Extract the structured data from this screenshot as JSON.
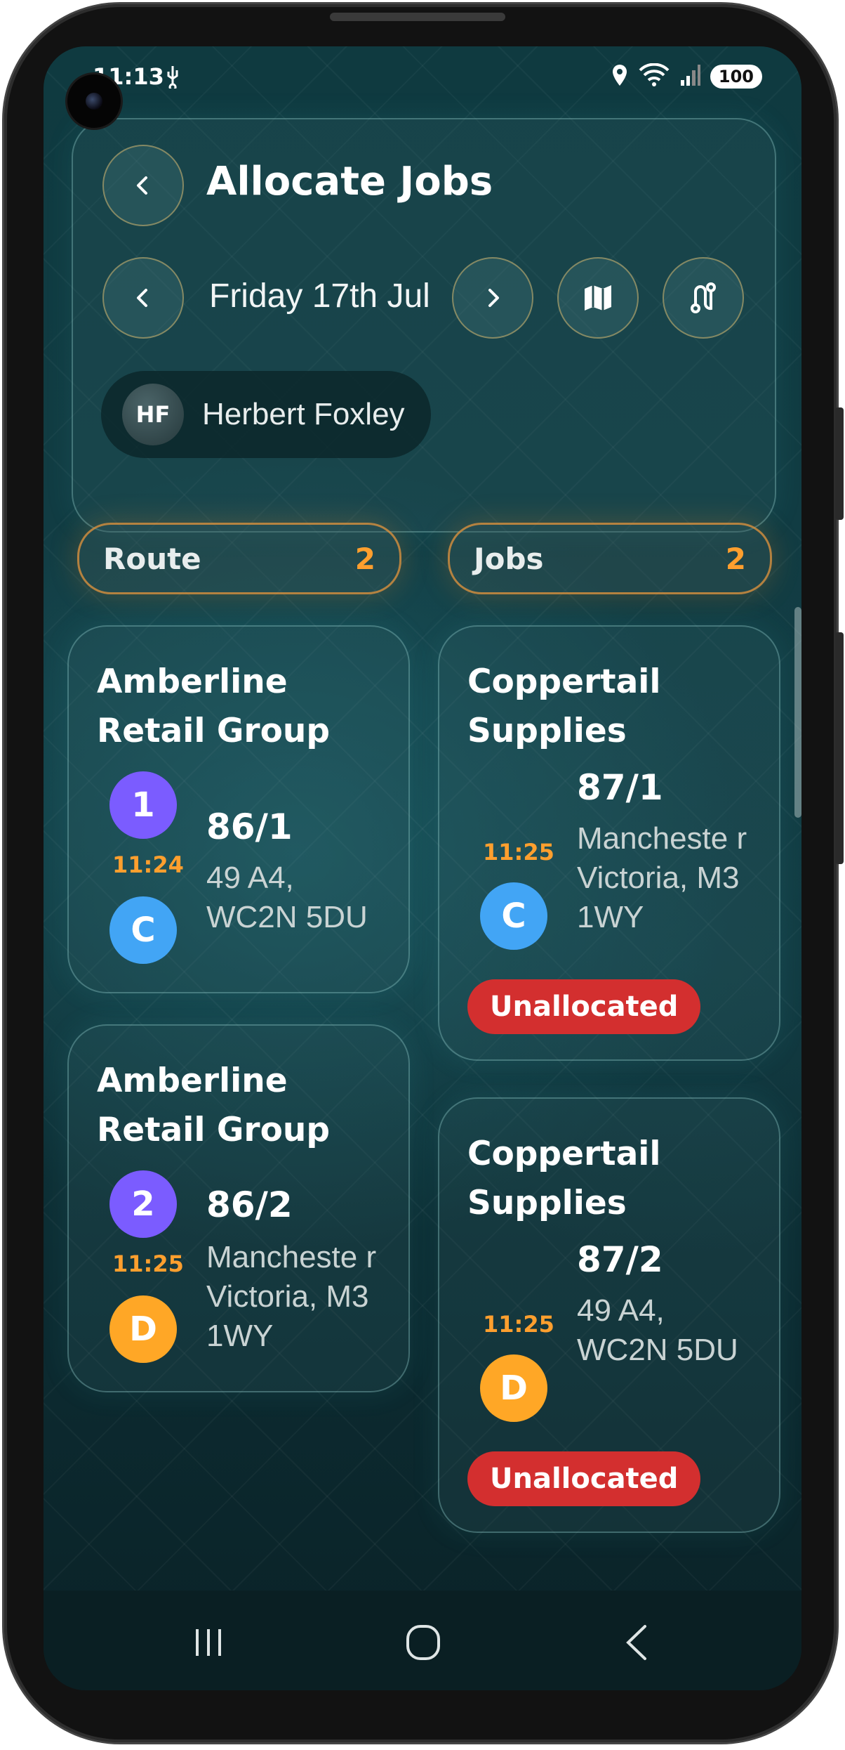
{
  "status_bar": {
    "time": "11:13",
    "battery": "100"
  },
  "header": {
    "title": "Allocate Jobs",
    "date": "Friday 17th Jul",
    "driver": {
      "initials": "HF",
      "name": "Herbert Foxley"
    }
  },
  "tabs": {
    "route": {
      "label": "Route",
      "count": "2"
    },
    "jobs": {
      "label": "Jobs",
      "count": "2"
    }
  },
  "route_cards": [
    {
      "company": "Amberline Retail Group",
      "seq": "1",
      "eta": "11:24",
      "type": "C",
      "ref": "86/1",
      "address": "49 A4, WC2N 5DU"
    },
    {
      "company": "Amberline Retail Group",
      "seq": "2",
      "eta": "11:25",
      "type": "D",
      "ref": "86/2",
      "address": "Mancheste r Victoria, M3 1WY"
    }
  ],
  "job_cards": [
    {
      "company": "Coppertail Supplies",
      "eta": "11:25",
      "type": "C",
      "ref": "87/1",
      "address": "Mancheste r Victoria, M3 1WY",
      "status": "Unallocated"
    },
    {
      "company": "Coppertail Supplies",
      "eta": "11:25",
      "type": "D",
      "ref": "87/2",
      "address": "49 A4, WC2N 5DU",
      "status": "Unallocated"
    }
  ],
  "colors": {
    "accent": "#ff9f2e",
    "unallocated": "#d32f2f",
    "seq_badge": "#7b5cff",
    "collect_badge": "#42a5f5",
    "deliver_badge": "#ffa726"
  },
  "icons": [
    "back-icon",
    "chevron-left-icon",
    "chevron-right-icon",
    "map-icon",
    "route-icon",
    "location-icon",
    "wifi-icon",
    "signal-icon",
    "usb-icon"
  ]
}
